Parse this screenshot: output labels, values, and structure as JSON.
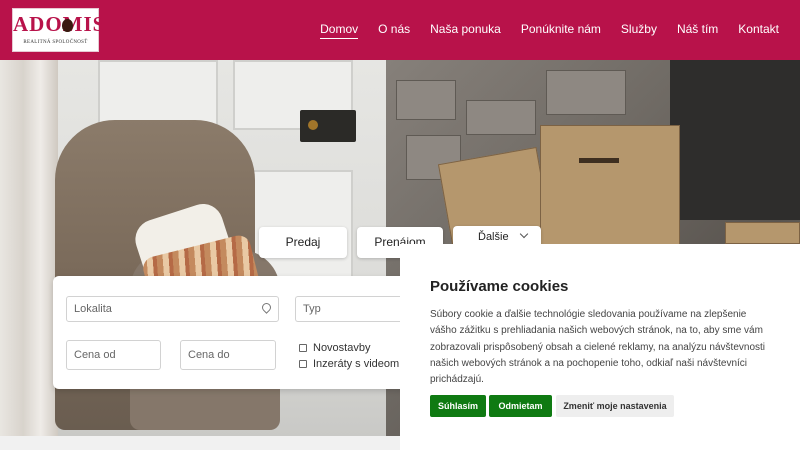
{
  "header": {
    "brand": "ADOMIS",
    "tagline": "REALITNÁ SPOLOČNOSŤ",
    "brand_color": "#b8124a",
    "nav": [
      {
        "label": "Domov",
        "active": true
      },
      {
        "label": "O nás",
        "active": false
      },
      {
        "label": "Naša ponuka",
        "active": false
      },
      {
        "label": "Ponúknite nám",
        "active": false
      },
      {
        "label": "Služby",
        "active": false
      },
      {
        "label": "Náš tím",
        "active": false
      },
      {
        "label": "Kontakt",
        "active": false
      }
    ]
  },
  "search": {
    "tabs": [
      "Predaj",
      "Prenájom"
    ],
    "more_label": "Ďalšie",
    "location_placeholder": "Lokalita",
    "type_placeholder": "Typ",
    "price_from_placeholder": "Cena od",
    "price_to_placeholder": "Cena do",
    "checkboxes": [
      "Novostavby",
      "Inzeráty s videom"
    ]
  },
  "cookie": {
    "title": "Používame cookies",
    "text": "Súbory cookie a ďalšie technológie sledovania používame na zlepšenie vášho zážitku s prehliadania našich webových stránok, na to, aby sme vám zobrazovali prispôsobený obsah a cielené reklamy, na analýzu návštevnosti našich webových stránok a na pochopenie toho, odkiaľ naši návštevníci prichádzajú.",
    "accept_label": "Súhlasím",
    "reject_label": "Odmietam",
    "settings_label": "Zmeniť moje nastavenia",
    "accent_color": "#0f7a12"
  }
}
